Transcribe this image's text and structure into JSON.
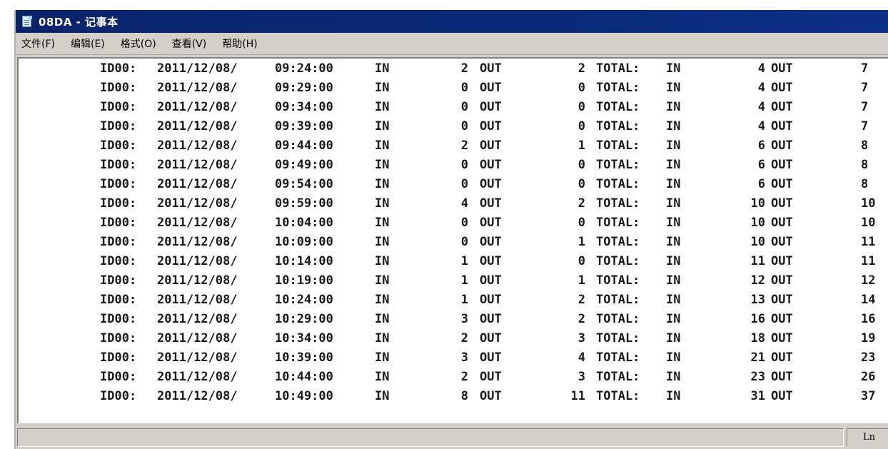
{
  "window": {
    "title": "08DA - 记事本"
  },
  "menu": [
    "文件(F)",
    "编辑(E)",
    "格式(O)",
    "查看(V)",
    "帮助(H)"
  ],
  "lines": [
    [
      "ID00:",
      "2011/12/08/",
      "09:24:00",
      "IN",
      "2",
      "OUT",
      "2",
      "TOTAL:",
      "IN",
      "4",
      "OUT",
      "7"
    ],
    [
      "ID00:",
      "2011/12/08/",
      "09:29:00",
      "IN",
      "0",
      "OUT",
      "0",
      "TOTAL:",
      "IN",
      "4",
      "OUT",
      "7"
    ],
    [
      "ID00:",
      "2011/12/08/",
      "09:34:00",
      "IN",
      "0",
      "OUT",
      "0",
      "TOTAL:",
      "IN",
      "4",
      "OUT",
      "7"
    ],
    [
      "ID00:",
      "2011/12/08/",
      "09:39:00",
      "IN",
      "0",
      "OUT",
      "0",
      "TOTAL:",
      "IN",
      "4",
      "OUT",
      "7"
    ],
    [
      "ID00:",
      "2011/12/08/",
      "09:44:00",
      "IN",
      "2",
      "OUT",
      "1",
      "TOTAL:",
      "IN",
      "6",
      "OUT",
      "8"
    ],
    [
      "ID00:",
      "2011/12/08/",
      "09:49:00",
      "IN",
      "0",
      "OUT",
      "0",
      "TOTAL:",
      "IN",
      "6",
      "OUT",
      "8"
    ],
    [
      "ID00:",
      "2011/12/08/",
      "09:54:00",
      "IN",
      "0",
      "OUT",
      "0",
      "TOTAL:",
      "IN",
      "6",
      "OUT",
      "8"
    ],
    [
      "ID00:",
      "2011/12/08/",
      "09:59:00",
      "IN",
      "4",
      "OUT",
      "2",
      "TOTAL:",
      "IN",
      "10",
      "OUT",
      "10"
    ],
    [
      "ID00:",
      "2011/12/08/",
      "10:04:00",
      "IN",
      "0",
      "OUT",
      "0",
      "TOTAL:",
      "IN",
      "10",
      "OUT",
      "10"
    ],
    [
      "ID00:",
      "2011/12/08/",
      "10:09:00",
      "IN",
      "0",
      "OUT",
      "1",
      "TOTAL:",
      "IN",
      "10",
      "OUT",
      "11"
    ],
    [
      "ID00:",
      "2011/12/08/",
      "10:14:00",
      "IN",
      "1",
      "OUT",
      "0",
      "TOTAL:",
      "IN",
      "11",
      "OUT",
      "11"
    ],
    [
      "ID00:",
      "2011/12/08/",
      "10:19:00",
      "IN",
      "1",
      "OUT",
      "1",
      "TOTAL:",
      "IN",
      "12",
      "OUT",
      "12"
    ],
    [
      "ID00:",
      "2011/12/08/",
      "10:24:00",
      "IN",
      "1",
      "OUT",
      "2",
      "TOTAL:",
      "IN",
      "13",
      "OUT",
      "14"
    ],
    [
      "ID00:",
      "2011/12/08/",
      "10:29:00",
      "IN",
      "3",
      "OUT",
      "2",
      "TOTAL:",
      "IN",
      "16",
      "OUT",
      "16"
    ],
    [
      "ID00:",
      "2011/12/08/",
      "10:34:00",
      "IN",
      "2",
      "OUT",
      "3",
      "TOTAL:",
      "IN",
      "18",
      "OUT",
      "19"
    ],
    [
      "ID00:",
      "2011/12/08/",
      "10:39:00",
      "IN",
      "3",
      "OUT",
      "4",
      "TOTAL:",
      "IN",
      "21",
      "OUT",
      "23"
    ],
    [
      "ID00:",
      "2011/12/08/",
      "10:44:00",
      "IN",
      "2",
      "OUT",
      "3",
      "TOTAL:",
      "IN",
      "23",
      "OUT",
      "26"
    ],
    [
      "ID00:",
      "2011/12/08/",
      "10:49:00",
      "IN",
      "8",
      "OUT",
      "11",
      "TOTAL:",
      "IN",
      "31",
      "OUT",
      "37"
    ]
  ],
  "status": {
    "position": "Ln"
  }
}
